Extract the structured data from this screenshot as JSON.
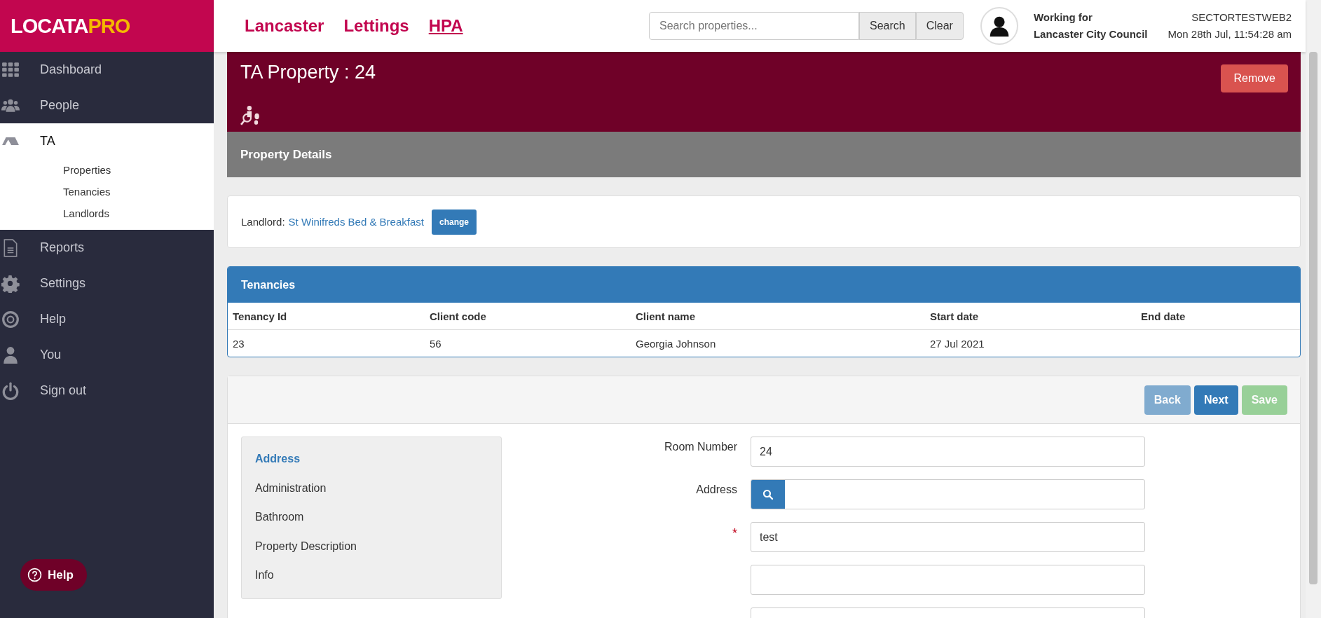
{
  "logo": {
    "part_1": "LOCATA",
    "part_2": "PRO"
  },
  "top_nav": [
    {
      "label": "Lancaster",
      "selected": false
    },
    {
      "label": "Lettings",
      "selected": false
    },
    {
      "label": "HPA",
      "selected": true
    }
  ],
  "search": {
    "placeholder": "Search properties...",
    "buttons": [
      "Search",
      "Clear"
    ]
  },
  "user": {
    "working_for_label": "Working for",
    "organisation": "Lancaster City Council",
    "server": "SECTORTESTWEB2",
    "datetime": "Mon 28th Jul, 11:54:28 am"
  },
  "sidebar": {
    "items": [
      {
        "label": "Dashboard",
        "expanded": false
      },
      {
        "label": "People",
        "expanded": false
      },
      {
        "label": "TA",
        "expanded": true,
        "children": [
          {
            "label": "Properties"
          },
          {
            "label": "Tenancies"
          },
          {
            "label": "Landlords"
          }
        ]
      },
      {
        "label": "Reports",
        "expanded": false
      },
      {
        "label": "Settings",
        "expanded": false
      },
      {
        "label": "Help",
        "expanded": false
      },
      {
        "label": "You",
        "expanded": false
      },
      {
        "label": "Sign out",
        "expanded": false
      }
    ]
  },
  "page_header": {
    "title": "TA Property : 24",
    "remove_button": "Remove",
    "section_title": "Property Details"
  },
  "landlord": {
    "label": "Landlord:",
    "name": "St Winifreds Bed & Breakfast",
    "change_button": "change"
  },
  "tenancies": {
    "title": "Tenancies",
    "columns": [
      "Tenancy Id",
      "Client code",
      "Client name",
      "Start date",
      "End date"
    ],
    "rows": [
      [
        "23",
        "56",
        "Georgia Johnson",
        "27 Jul 2021"
      ]
    ]
  },
  "form_toolbar": [
    {
      "label": "Back",
      "kind": "back",
      "disabled": true
    },
    {
      "label": "Next",
      "kind": "next",
      "disabled": false
    },
    {
      "label": "Save",
      "kind": "save",
      "disabled": true
    }
  ],
  "form_nav": [
    {
      "label": "Address",
      "selected": true
    },
    {
      "label": "Administration",
      "selected": false
    },
    {
      "label": "Bathroom",
      "selected": false
    },
    {
      "label": "Property Description",
      "selected": false
    },
    {
      "label": "Info",
      "selected": false
    }
  ],
  "fields": [
    {
      "label": "Room Number",
      "kind": "text",
      "value": "24",
      "required": false
    },
    {
      "label": "Address",
      "kind": "search",
      "required": false
    },
    {
      "label": "*",
      "kind": "text",
      "value": "test",
      "required": true
    },
    {
      "kind": "text"
    },
    {
      "kind": "text"
    }
  ],
  "help_button": "Help"
}
